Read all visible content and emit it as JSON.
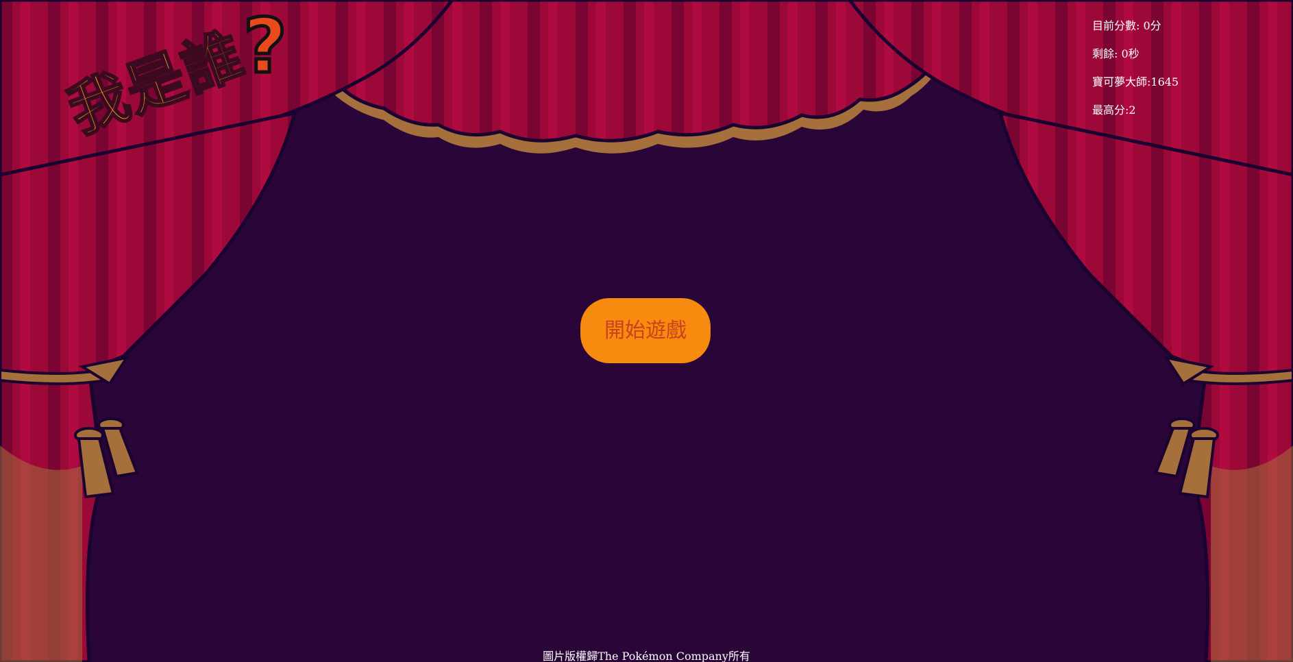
{
  "logo": {
    "title": "我是誰",
    "mark": "?"
  },
  "hud": {
    "score": "目前分數: 0分",
    "time_left": "剩餘: 0秒",
    "master": "寶可夢大師:1645",
    "high_score": "最高分:2"
  },
  "start_button": {
    "label": "開始遊戲"
  },
  "footer": {
    "copyright": "圖片版權歸The Pokémon Company所有"
  },
  "colors": {
    "background": "#2a0538",
    "curtain": "#a0083a",
    "trim": "#a5703c",
    "button": "#f78b0f",
    "button_text": "#c8431d",
    "logo": "#f7a70f"
  }
}
